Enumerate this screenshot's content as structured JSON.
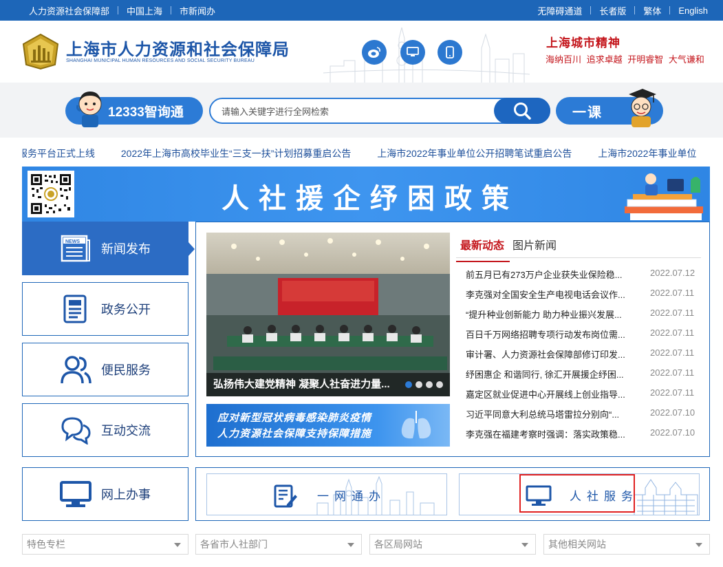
{
  "topbar": {
    "left_links": [
      "人力资源社会保障部",
      "中国上海",
      "市新闻办"
    ],
    "right_links": [
      "无障碍通道",
      "长者版",
      "繁体",
      "English"
    ]
  },
  "header": {
    "title_cn": "上海市人力资源和社会保障局",
    "title_en": "SHANGHAI MUNICIPAL HUMAN RESOURCES AND SOCIAL SECURITY BUREAU",
    "spirit_title": "上海城市精神",
    "spirit_sub": "海纳百川 追求卓越 开明睿智 大气谦和",
    "quick_icons": [
      "weibo-icon",
      "desktop-icon",
      "mobile-icon"
    ]
  },
  "search": {
    "pill_left_label": "12333智询通",
    "placeholder": "请输入关键字进行全网检索",
    "pill_right_label": "一课"
  },
  "ticker": [
    "服务平台正式上线",
    "2022年上海市高校毕业生“三支一扶”计划招募重启公告",
    "上海市2022年事业单位公开招聘笔试重启公告",
    "上海市2022年事业单位"
  ],
  "banner": {
    "title": "人社援企纾困政策"
  },
  "nav": [
    {
      "label": "新闻发布",
      "icon": "news-icon"
    },
    {
      "label": "政务公开",
      "icon": "document-icon"
    },
    {
      "label": "便民服务",
      "icon": "people-icon"
    },
    {
      "label": "互动交流",
      "icon": "chat-icon"
    },
    {
      "label": "网上办事",
      "icon": "monitor-icon"
    }
  ],
  "news": {
    "photo_caption": "弘扬伟大建党精神 凝聚人社奋进力量...",
    "covid_line1": "应对新型冠状病毒感染肺炎疫情",
    "covid_line2": "人力资源社会保障支持保障措施",
    "tabs": [
      "最新动态",
      "图片新闻"
    ],
    "items": [
      {
        "title": "前五月已有273万户企业获失业保险稳...",
        "date": "2022.07.12"
      },
      {
        "title": "李克强对全国安全生产电视电话会议作...",
        "date": "2022.07.11"
      },
      {
        "title": "“提升种业创新能力 助力种业振兴发展...",
        "date": "2022.07.11"
      },
      {
        "title": "百日千万网络招聘专项行动发布岗位需...",
        "date": "2022.07.11"
      },
      {
        "title": "审计署、人力资源社会保障部修订印发...",
        "date": "2022.07.11"
      },
      {
        "title": "纾困惠企 和谐同行, 徐汇开展援企纾困...",
        "date": "2022.07.11"
      },
      {
        "title": "嘉定区就业促进中心开展线上创业指导...",
        "date": "2022.07.11"
      },
      {
        "title": "习近平同意大利总统马塔雷拉分别向“...",
        "date": "2022.07.10"
      },
      {
        "title": "李克强在福建考察时强调：落实政策稳...",
        "date": "2022.07.10"
      }
    ]
  },
  "services": [
    "一网通办",
    "人社服务"
  ],
  "selects": [
    "特色专栏",
    "各省市人社部门",
    "各区局网站",
    "其他相关网站"
  ],
  "colors": {
    "primary": "#1d66b8",
    "accent_red": "#c4161c",
    "button_blue": "#2c7bd6"
  }
}
